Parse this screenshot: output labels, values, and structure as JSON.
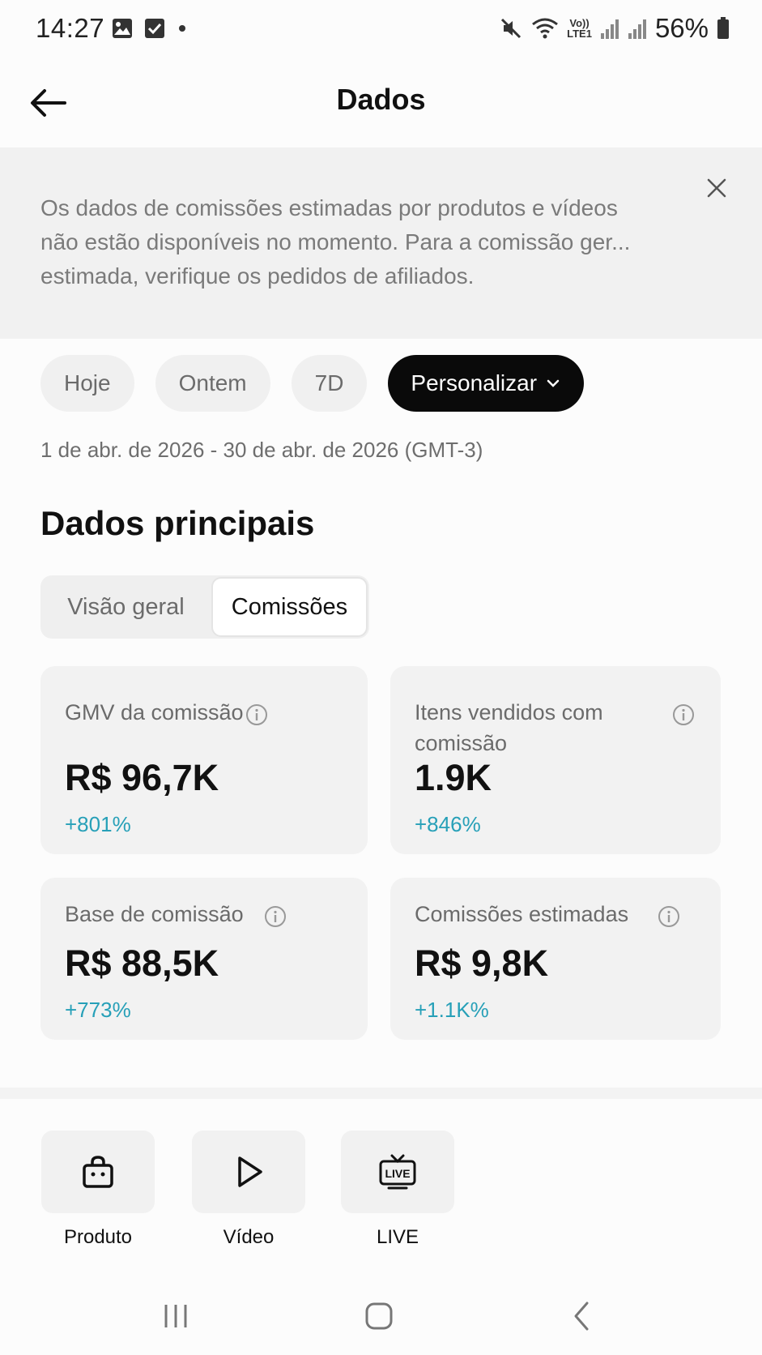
{
  "status_bar": {
    "time": "14:27",
    "battery": "56%",
    "icons": [
      "image-icon",
      "checkbox-icon",
      "dot-icon",
      "mute-icon",
      "wifi-icon",
      "volte-icon",
      "signal-icon",
      "signal-icon",
      "battery-icon"
    ],
    "volte_label_top": "Vo))",
    "volte_label_bottom": "LTE1"
  },
  "header": {
    "title": "Dados",
    "back_icon": "arrow-left-icon"
  },
  "banner": {
    "text": "Os dados de comissões estimadas por produtos e vídeos\nnão estão disponíveis no momento. Para a comissão ger...\nestimada, verifique os pedidos de afiliados.",
    "close_icon": "close-icon"
  },
  "filters": {
    "chips": [
      "Hoje",
      "Ontem",
      "7D"
    ],
    "custom_label": "Personalizar",
    "custom_icon": "chevron-down-icon"
  },
  "date_range": "1 de abr. de 2026 - 30 de abr. de 2026 (GMT-3)",
  "main": {
    "section_title": "Dados principais",
    "tabs": [
      "Visão geral",
      "Comissões"
    ],
    "active_tab": "Comissões",
    "metrics": [
      {
        "label": "GMV da comissão",
        "value": "R$ 96,7K",
        "change": "+801%"
      },
      {
        "label": "Itens vendidos com comissão",
        "value": "1.9K",
        "change": "+846%"
      },
      {
        "label": "Base de comissão",
        "value": "R$ 88,5K",
        "change": "+773%"
      },
      {
        "label": "Comissões estimadas",
        "value": "R$ 9,8K",
        "change": "+1.1K%"
      }
    ],
    "change_color": "#27a0b8"
  },
  "shortcuts": [
    {
      "label": "Produto",
      "icon": "shopping-bag-icon"
    },
    {
      "label": "Vídeo",
      "icon": "play-icon"
    },
    {
      "label": "LIVE",
      "icon": "live-tv-icon"
    }
  ],
  "nav": {
    "icons": [
      "recent-apps-icon",
      "home-icon",
      "back-icon"
    ]
  }
}
